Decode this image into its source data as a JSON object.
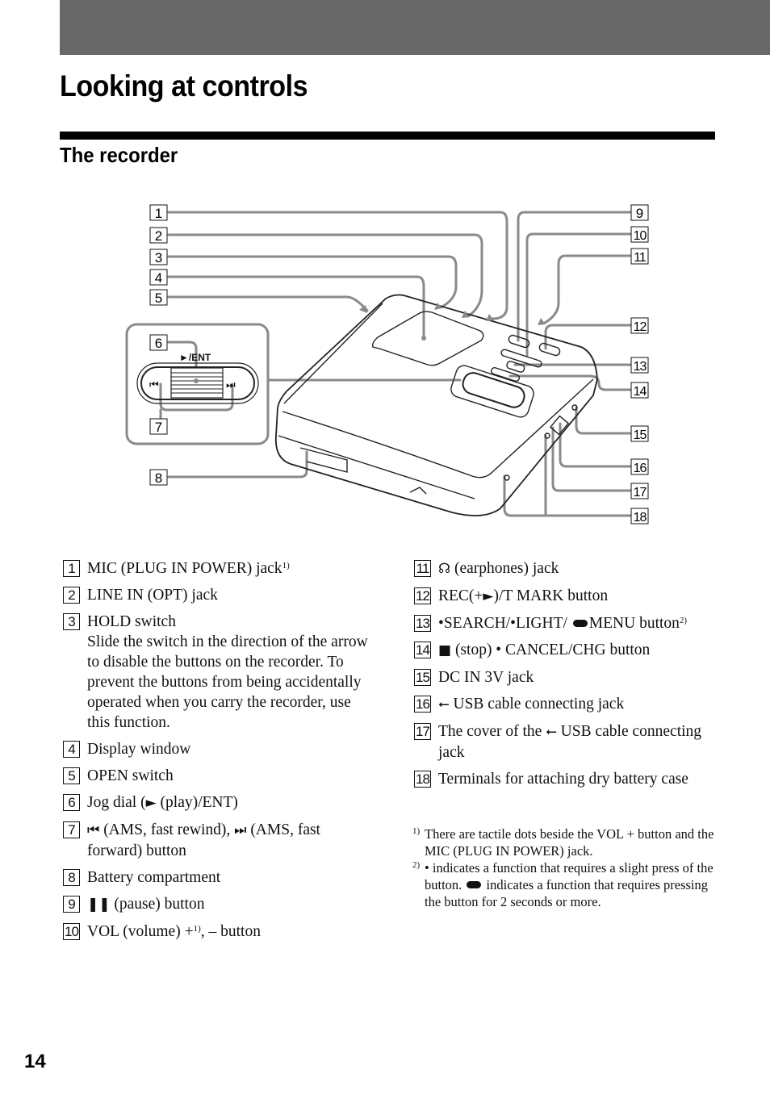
{
  "page": {
    "title": "Looking at controls",
    "section": "The recorder",
    "page_number": "14",
    "colors": {
      "header_bar": "#686868",
      "callout_line": "#8a8a8a",
      "text": "#111111"
    }
  },
  "diagram": {
    "callouts_left": [
      "1",
      "2",
      "3",
      "4",
      "5",
      "6",
      "7",
      "8"
    ],
    "callouts_right": [
      "9",
      "10",
      "11",
      "12",
      "13",
      "14",
      "15",
      "16",
      "17",
      "18"
    ],
    "jog_label": "►/ENT"
  },
  "items": [
    {
      "num": "1",
      "text": "MIC (PLUG IN POWER) jack",
      "sup": "1)"
    },
    {
      "num": "2",
      "text": "LINE IN (OPT) jack"
    },
    {
      "num": "3",
      "text": "HOLD switch",
      "detail": "Slide the switch in the direction of the arrow to disable the buttons on the recorder. To prevent the buttons from being accidentally operated when you carry the recorder, use this function."
    },
    {
      "num": "4",
      "text": "Display window"
    },
    {
      "num": "5",
      "text": "OPEN switch"
    },
    {
      "num": "6",
      "pre": "Jog dial (",
      "icon": "play-icon",
      "glyph": "►",
      "text": " (play)/ENT)"
    },
    {
      "num": "7",
      "icon": "previous-icon",
      "glyph": "⏮",
      "text": " (AMS, fast rewind), ",
      "icon2": "next-icon",
      "glyph2": "⏭",
      "text2": " (AMS, fast forward) button"
    },
    {
      "num": "8",
      "text": "Battery compartment"
    },
    {
      "num": "9",
      "icon": "pause-icon",
      "glyph": "❚❚",
      "text": " (pause) button"
    },
    {
      "num": "10",
      "text": "VOL (volume) +",
      "sup": "1)",
      "text2": ", – button"
    },
    {
      "num": "11",
      "icon": "earphones-icon",
      "glyph": "☊",
      "text": " (earphones) jack"
    },
    {
      "num": "12",
      "text": "REC(+",
      "icon": "play-icon",
      "glyph": "►",
      "text2": ")/T MARK button"
    },
    {
      "num": "13",
      "text": "•SEARCH/•LIGHT/ ",
      "icon": "long-press-icon",
      "text2": "MENU button",
      "sup": "2)"
    },
    {
      "num": "14",
      "icon": "stop-icon",
      "glyph": "■",
      "text": " (stop) • CANCEL/CHG button"
    },
    {
      "num": "15",
      "text": "DC IN 3V jack"
    },
    {
      "num": "16",
      "icon": "usb-icon",
      "glyph": "⭠",
      "text": " USB cable connecting jack"
    },
    {
      "num": "17",
      "pre": "The cover of the ",
      "icon": "usb-icon",
      "glyph": "⭠",
      "text": " USB cable connecting jack"
    },
    {
      "num": "18",
      "text": "Terminals for attaching dry battery case"
    }
  ],
  "footnotes": [
    {
      "mark": "1)",
      "text": "There are tactile dots beside the VOL + button and the MIC (PLUG IN POWER) jack."
    },
    {
      "mark": "2)",
      "pre": "• indicates a function that requires a slight press of the button. ",
      "icon": "long-press-icon",
      "text": " indicates a function that requires pressing the button for 2 seconds or more."
    }
  ]
}
